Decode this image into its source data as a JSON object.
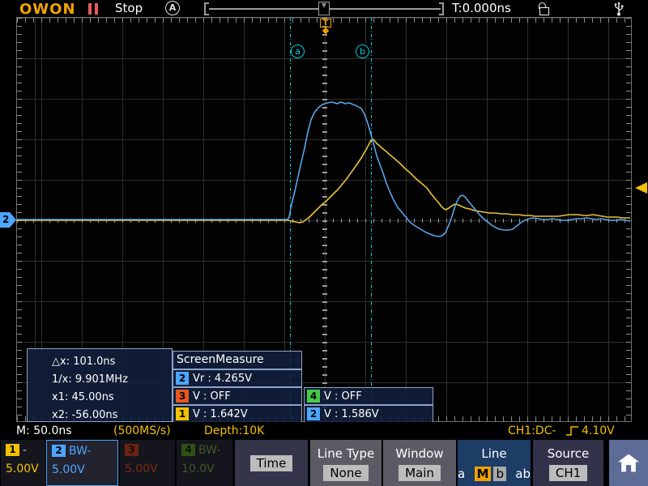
{
  "header": {
    "logo": "OWON",
    "run_state": "Stop",
    "auto_badge": "A",
    "trigger_time": "T:0.000ns"
  },
  "scope": {
    "cursor_a_label": "a",
    "cursor_b_label": "b",
    "trigger_marker": "T",
    "channel2_marker": "2",
    "colors": {
      "ch1_trace": "#e8c23a",
      "ch2_trace": "#5aa5e8",
      "cursor": "#00ced8",
      "trigger": "#f0a000"
    },
    "waveforms": {
      "ch1_points": "20,272 340,272 356,272 360,273 365,274 370,275 374,274 378,271 382,268 387,263 392,258 397,253 402,249 407,244 412,239 417,234 422,228 427,222 432,215 437,208 442,201 446,195 450,188 453,183 456,177 458,173 461,172 465,177 472,183 479,189 486,195 493,201 500,208 507,214 514,221 520,226 527,232 532,239 537,245 542,251 546,256 550,259 554,257 558,254 562,252 566,253 570,255 575,257 580,258 586,260 592,261 598,262 605,263 612,263 619,264 626,264 633,265 640,265 647,266 654,266 661,267 668,267 675,267 682,267 689,267 696,266 702,265 708,265 714,265 720,266 726,266 732,265 738,266 744,267 750,268 756,268 762,268 768,269 774,269 778,269",
      "ch2_points": "20,271 340,271 355,271 357,268 360,252 364,236 368,218 372,200 376,183 380,163 384,148 388,139 393,133 398,129 404,127 410,126 416,128 421,126 426,128 431,127 436,129 441,131 446,134 450,141 454,152 458,166 461,177 465,192 469,203 473,214 477,226 481,236 486,247 491,256 496,262 501,268 506,274 511,278 516,281 521,284 526,287 531,289 536,291 541,292 546,291 550,287 554,278 558,267 562,254 565,247 568,242 571,241 574,243 578,248 582,253 587,259 592,265 597,270 602,274 607,278 612,281 617,283 622,284 628,284 633,283 638,279 643,275 648,272 653,270 658,269 664,270 670,271 676,271 682,270 688,271 694,272 700,272 706,271 712,270 718,270 724,269 730,270 736,271 742,270 748,271 754,272 760,272 766,271 772,272 778,273"
    }
  },
  "cursor_readout": {
    "dx": "△x: 101.0ns",
    "inv_dx": "1/x: 9.901MHz",
    "x1": "x1: 45.00ns",
    "x2": "x2: -56.00ns"
  },
  "screen_measure": {
    "title": "ScreenMeasure",
    "rows": [
      {
        "ch": "2",
        "color": "#4da6ff",
        "text": "Vr : 4.265V"
      },
      {
        "ch": "3",
        "color": "#e8571c",
        "text": "V : OFF"
      },
      {
        "ch": "1",
        "color": "#f2c200",
        "text": "V : 1.642V"
      },
      {
        "ch": "4",
        "color": "#44cc44",
        "text": "V : OFF"
      },
      {
        "ch": "2",
        "color": "#4da6ff",
        "text": "V : 1.586V"
      }
    ]
  },
  "status_bar": {
    "timebase": "M: 50.0ns",
    "sample_rate": "(500MS/s)",
    "depth": "Depth:10K",
    "trigger_info": "CH1:DC-",
    "trigger_level": "4.10V"
  },
  "bottom_menu": {
    "ch1": {
      "num": "1",
      "color": "#f2c200",
      "suffix": "-",
      "scale": "5.00V"
    },
    "ch2": {
      "num": "2",
      "color": "#4da6ff",
      "suffix": "BW-",
      "scale": "5.00V"
    },
    "ch3": {
      "num": "3",
      "color": "#6b2412",
      "suffix": "-",
      "scale": "5.00V"
    },
    "ch4": {
      "num": "4",
      "color": "#2f5214",
      "suffix": "BW-",
      "scale": "10.0V"
    },
    "time_button": "Time",
    "line_type": {
      "label": "Line Type",
      "value": "None"
    },
    "window": {
      "label": "Window",
      "value": "Main"
    },
    "line": {
      "label": "Line",
      "opt_a": "a",
      "opt_m": "M",
      "opt_b": "b",
      "opt_ab": "ab"
    },
    "source": {
      "label": "Source",
      "value": "CH1"
    }
  }
}
